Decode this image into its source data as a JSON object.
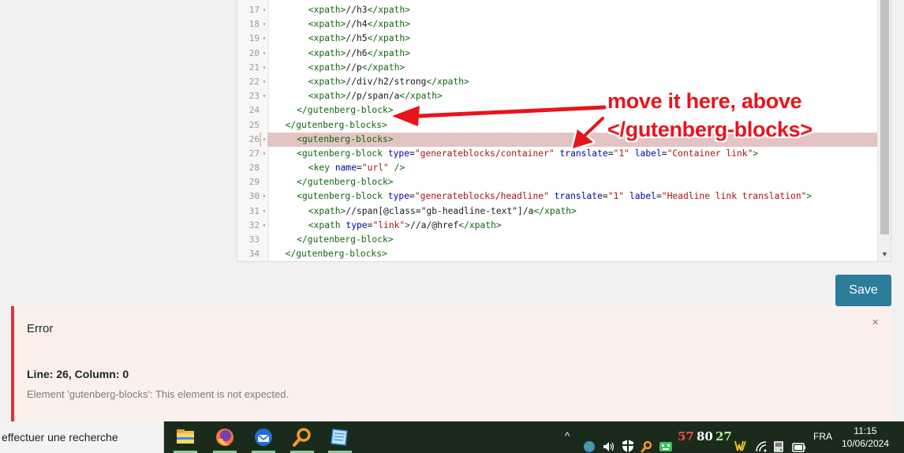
{
  "editor": {
    "lines": [
      {
        "n": "17",
        "fold": "▾",
        "indent": 3,
        "parts": [
          [
            "t",
            "<xpath>"
          ],
          [
            "p",
            "//h3"
          ],
          [
            "t",
            "</xpath>"
          ]
        ]
      },
      {
        "n": "18",
        "fold": "▾",
        "indent": 3,
        "parts": [
          [
            "t",
            "<xpath>"
          ],
          [
            "p",
            "//h4"
          ],
          [
            "t",
            "</xpath>"
          ]
        ]
      },
      {
        "n": "19",
        "fold": "▾",
        "indent": 3,
        "parts": [
          [
            "t",
            "<xpath>"
          ],
          [
            "p",
            "//h5"
          ],
          [
            "t",
            "</xpath>"
          ]
        ]
      },
      {
        "n": "20",
        "fold": "▾",
        "indent": 3,
        "parts": [
          [
            "t",
            "<xpath>"
          ],
          [
            "p",
            "//h6"
          ],
          [
            "t",
            "</xpath>"
          ]
        ]
      },
      {
        "n": "21",
        "fold": "▾",
        "indent": 3,
        "parts": [
          [
            "t",
            "<xpath>"
          ],
          [
            "p",
            "//p"
          ],
          [
            "t",
            "</xpath>"
          ]
        ]
      },
      {
        "n": "22",
        "fold": "▾",
        "indent": 3,
        "parts": [
          [
            "t",
            "<xpath>"
          ],
          [
            "p",
            "//div/h2/strong"
          ],
          [
            "t",
            "</xpath>"
          ]
        ]
      },
      {
        "n": "23",
        "fold": "▾",
        "indent": 3,
        "parts": [
          [
            "t",
            "<xpath>"
          ],
          [
            "p",
            "//p/span/a"
          ],
          [
            "t",
            "</xpath>"
          ]
        ]
      },
      {
        "n": "24",
        "fold": "",
        "indent": 2,
        "parts": [
          [
            "t",
            "</gutenberg-block>"
          ]
        ]
      },
      {
        "n": "25",
        "fold": "",
        "indent": 1,
        "parts": [
          [
            "t",
            "</gutenberg-blocks>"
          ]
        ]
      },
      {
        "n": "26",
        "fold": "▾",
        "indent": 2,
        "highlight": true,
        "parts": [
          [
            "t",
            "<gutenberg-blocks>"
          ]
        ]
      },
      {
        "n": "27",
        "fold": "▾",
        "indent": 2,
        "parts": [
          [
            "t",
            "<gutenberg-block "
          ],
          [
            "a",
            "type"
          ],
          [
            "p",
            "="
          ],
          [
            "s",
            "\"generateblocks/container\""
          ],
          [
            "p",
            " "
          ],
          [
            "a",
            "translate"
          ],
          [
            "p",
            "="
          ],
          [
            "s",
            "\"1\""
          ],
          [
            "p",
            " "
          ],
          [
            "a",
            "label"
          ],
          [
            "p",
            "="
          ],
          [
            "s",
            "\"Container link\""
          ],
          [
            "t",
            ">"
          ]
        ]
      },
      {
        "n": "28",
        "fold": "",
        "indent": 3,
        "parts": [
          [
            "t",
            "<key "
          ],
          [
            "a",
            "name"
          ],
          [
            "p",
            "="
          ],
          [
            "s",
            "\"url\""
          ],
          [
            "t",
            " />"
          ]
        ]
      },
      {
        "n": "29",
        "fold": "",
        "indent": 2,
        "parts": [
          [
            "t",
            "</gutenberg-block>"
          ]
        ]
      },
      {
        "n": "30",
        "fold": "▾",
        "indent": 2,
        "parts": [
          [
            "t",
            "<gutenberg-block "
          ],
          [
            "a",
            "type"
          ],
          [
            "p",
            "="
          ],
          [
            "s",
            "\"generateblocks/headline\""
          ],
          [
            "p",
            " "
          ],
          [
            "a",
            "translate"
          ],
          [
            "p",
            "="
          ],
          [
            "s",
            "\"1\""
          ],
          [
            "p",
            " "
          ],
          [
            "a",
            "label"
          ],
          [
            "p",
            "="
          ],
          [
            "s",
            "\"Headline link translation\""
          ],
          [
            "t",
            ">"
          ]
        ]
      },
      {
        "n": "31",
        "fold": "▾",
        "indent": 3,
        "parts": [
          [
            "t",
            "<xpath>"
          ],
          [
            "p",
            "//span[@class=\"gb-headline-text\"]/a"
          ],
          [
            "t",
            "</xpath>"
          ]
        ]
      },
      {
        "n": "32",
        "fold": "▾",
        "indent": 3,
        "parts": [
          [
            "t",
            "<xpath "
          ],
          [
            "a",
            "type"
          ],
          [
            "p",
            "="
          ],
          [
            "s",
            "\"link\""
          ],
          [
            "t",
            ">"
          ],
          [
            "p",
            "//a/@href"
          ],
          [
            "t",
            "</xpath>"
          ]
        ]
      },
      {
        "n": "33",
        "fold": "",
        "indent": 2,
        "parts": [
          [
            "t",
            "</gutenberg-block>"
          ]
        ]
      },
      {
        "n": "34",
        "fold": "",
        "indent": 1,
        "parts": [
          [
            "t",
            "</gutenberg-blocks>"
          ]
        ]
      }
    ]
  },
  "annotation": {
    "line1": "move it here, above",
    "line2": "</gutenberg-blocks>",
    "color": "#e8141c"
  },
  "save_button": {
    "label": "Save",
    "color": "#2d7d9a"
  },
  "error": {
    "title": "Error",
    "close": "×",
    "location": "Line: 26, Column: 0",
    "message": "Element 'gutenberg-blocks': This element is not expected."
  },
  "taskbar": {
    "search_text": "effectuer une recherche",
    "apps": [
      "file-explorer-icon",
      "firefox-icon",
      "thunderbird-icon",
      "search-tool-icon",
      "notepad-icon"
    ],
    "tray_numbers": [
      "57",
      "80",
      "27"
    ],
    "language": "FRA",
    "time": "11:15",
    "date": "10/06/2024"
  }
}
